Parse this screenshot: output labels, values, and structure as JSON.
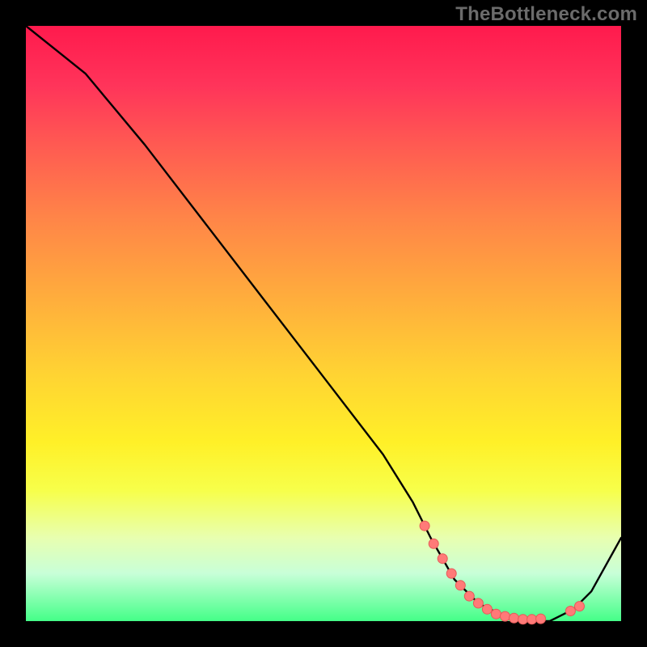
{
  "attribution": "TheBottleneck.com",
  "colors": {
    "curve": "#000000",
    "marker_fill": "#ff7a78",
    "marker_stroke": "#e65a58",
    "background_top": "#ff1a4d",
    "background_bottom": "#44ff88"
  },
  "chart_data": {
    "type": "line",
    "title": "",
    "xlabel": "",
    "ylabel": "",
    "xlim": [
      0,
      100
    ],
    "ylim": [
      0,
      100
    ],
    "grid": false,
    "legend": false,
    "series": [
      {
        "name": "curve",
        "x": [
          0,
          5,
          10,
          20,
          30,
          40,
          50,
          60,
          65,
          68,
          72,
          76,
          80,
          84,
          88,
          92,
          95,
          100
        ],
        "values": [
          100,
          96,
          92,
          80,
          67,
          54,
          41,
          28,
          20,
          14,
          7,
          3,
          1,
          0,
          0,
          2,
          5,
          14
        ]
      }
    ],
    "markers": [
      {
        "x": 67.0,
        "y": 16.0
      },
      {
        "x": 68.5,
        "y": 13.0
      },
      {
        "x": 70.0,
        "y": 10.5
      },
      {
        "x": 71.5,
        "y": 8.0
      },
      {
        "x": 73.0,
        "y": 6.0
      },
      {
        "x": 74.5,
        "y": 4.2
      },
      {
        "x": 76.0,
        "y": 3.0
      },
      {
        "x": 77.5,
        "y": 2.0
      },
      {
        "x": 79.0,
        "y": 1.2
      },
      {
        "x": 80.5,
        "y": 0.8
      },
      {
        "x": 82.0,
        "y": 0.5
      },
      {
        "x": 83.5,
        "y": 0.3
      },
      {
        "x": 85.0,
        "y": 0.3
      },
      {
        "x": 86.5,
        "y": 0.4
      },
      {
        "x": 91.5,
        "y": 1.7
      },
      {
        "x": 93.0,
        "y": 2.5
      }
    ]
  }
}
